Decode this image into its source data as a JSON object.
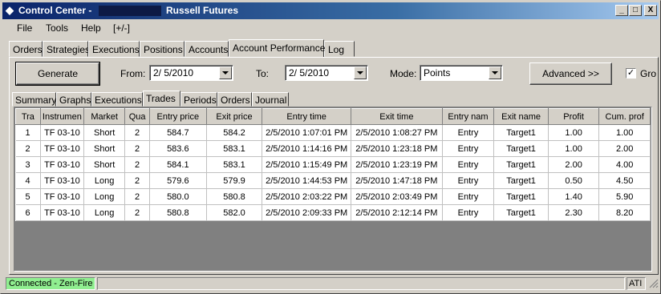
{
  "window": {
    "title_prefix": "Control Center -",
    "title_suffix": "Russell Futures",
    "buttons": {
      "minimize": "_",
      "maximize": "□",
      "close": "X"
    }
  },
  "menu": [
    "File",
    "Tools",
    "Help",
    "[+/-]"
  ],
  "top_tabs": [
    "Orders",
    "Strategies",
    "Executions",
    "Positions",
    "Accounts",
    "Account Performance",
    "Log"
  ],
  "active_top_tab": "Account Performance",
  "controls": {
    "generate_label": "Generate",
    "from_label": "From:",
    "from_value": "2/  5/2010",
    "to_label": "To:",
    "to_value": "2/  5/2010",
    "mode_label": "Mode:",
    "mode_value": "Points",
    "advanced_label": "Advanced >>",
    "group_checkbox_label": "Gro",
    "group_checked": true
  },
  "sub_tabs": [
    "Summary",
    "Graphs",
    "Executions",
    "Trades",
    "Periods",
    "Orders",
    "Journal"
  ],
  "active_sub_tab": "Trades",
  "table": {
    "headers": [
      "Tra",
      "Instrumen",
      "Market",
      "Qua",
      "Entry price",
      "Exit price",
      "Entry time",
      "Exit time",
      "Entry nam",
      "Exit name",
      "Profit",
      "Cum. prof"
    ],
    "rows": [
      [
        "1",
        "TF 03-10",
        "Short",
        "2",
        "584.7",
        "584.2",
        "2/5/2010 1:07:01 PM",
        "2/5/2010 1:08:27 PM",
        "Entry",
        "Target1",
        "1.00",
        "1.00"
      ],
      [
        "2",
        "TF 03-10",
        "Short",
        "2",
        "583.6",
        "583.1",
        "2/5/2010 1:14:16 PM",
        "2/5/2010 1:23:18 PM",
        "Entry",
        "Target1",
        "1.00",
        "2.00"
      ],
      [
        "3",
        "TF 03-10",
        "Short",
        "2",
        "584.1",
        "583.1",
        "2/5/2010 1:15:49 PM",
        "2/5/2010 1:23:19 PM",
        "Entry",
        "Target1",
        "2.00",
        "4.00"
      ],
      [
        "4",
        "TF 03-10",
        "Long",
        "2",
        "579.6",
        "579.9",
        "2/5/2010 1:44:53 PM",
        "2/5/2010 1:47:18 PM",
        "Entry",
        "Target1",
        "0.50",
        "4.50"
      ],
      [
        "5",
        "TF 03-10",
        "Long",
        "2",
        "580.0",
        "580.8",
        "2/5/2010 2:03:22 PM",
        "2/5/2010 2:03:49 PM",
        "Entry",
        "Target1",
        "1.40",
        "5.90"
      ],
      [
        "6",
        "TF 03-10",
        "Long",
        "2",
        "580.8",
        "582.0",
        "2/5/2010 2:09:33 PM",
        "2/5/2010 2:12:14 PM",
        "Entry",
        "Target1",
        "2.30",
        "8.20"
      ]
    ]
  },
  "status": {
    "connection": "Connected - Zen-Fire",
    "connection_color": "#90ee90",
    "right": "ATI"
  },
  "colors": {
    "title_gradient_start": "#0a246a",
    "title_gradient_end": "#a6caf0",
    "grid_empty_bg": "#808080"
  }
}
